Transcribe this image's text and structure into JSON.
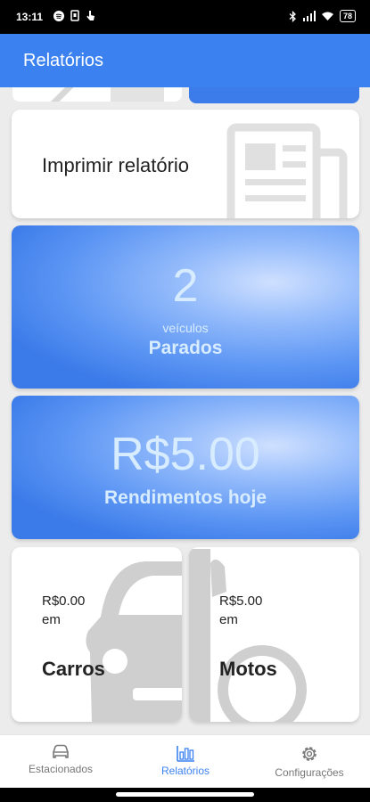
{
  "status_bar": {
    "time": "13:11",
    "battery": "78"
  },
  "app_bar": {
    "title": "Relatórios"
  },
  "cards": {
    "print_report": {
      "label": "Imprimir relatório"
    },
    "parked": {
      "count": "2",
      "unit": "veículos",
      "label": "Parados"
    },
    "earnings": {
      "amount": "R$5.00",
      "label": "Rendimentos hoje"
    },
    "cars": {
      "amount": "R$0.00",
      "suffix": "em",
      "label": "Carros"
    },
    "motos": {
      "amount": "R$5.00",
      "suffix": "em",
      "label": "Motos"
    }
  },
  "bottom_nav": {
    "items": [
      {
        "label": "Estacionados",
        "icon": "car-icon"
      },
      {
        "label": "Relatórios",
        "icon": "bar-chart-icon",
        "active": true
      },
      {
        "label": "Configurações",
        "icon": "gear-icon"
      }
    ]
  },
  "colors": {
    "primary": "#3b82f0",
    "card_text": "#d8ecff"
  }
}
